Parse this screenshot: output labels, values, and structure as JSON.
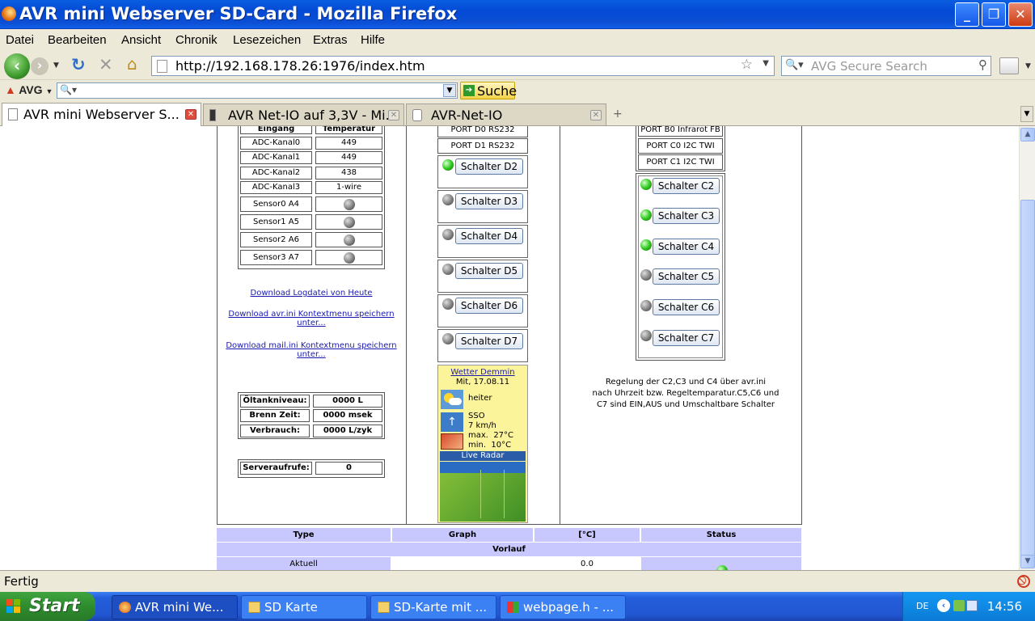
{
  "window": {
    "title": "AVR mini Webserver SD-Card - Mozilla Firefox",
    "min": "_",
    "max": "❐",
    "close": "✕"
  },
  "menu": [
    "Datei",
    "Bearbeiten",
    "Ansicht",
    "Chronik",
    "Lesezeichen",
    "Extras",
    "Hilfe"
  ],
  "nav": {
    "url": "http://192.168.178.26:1976/index.htm",
    "search_placeholder": "AVG Secure Search"
  },
  "avg": {
    "logo": "AVG",
    "search_button": "Suche"
  },
  "tabs": [
    {
      "label": "AVR mini Webserver S..."
    },
    {
      "label": "AVR Net-IO auf 3,3V - Mi..."
    },
    {
      "label": "AVR-Net-IO"
    }
  ],
  "page": {
    "left": {
      "head": [
        "Eingang",
        "Temperatur"
      ],
      "rows": [
        {
          "name": "ADC-Kanal0",
          "val": "449"
        },
        {
          "name": "ADC-Kanal1",
          "val": "449"
        },
        {
          "name": "ADC-Kanal2",
          "val": "438"
        },
        {
          "name": "ADC-Kanal3",
          "val": "1-wire"
        }
      ],
      "sensors": [
        "Sensor0 A4",
        "Sensor1 A5",
        "Sensor2 A6",
        "Sensor3 A7"
      ],
      "links": [
        "Download Logdatei von Heute",
        "Download avr.ini Kontextmenu speichern unter...",
        "Download mail.ini Kontextmenu speichern unter..."
      ],
      "stats": [
        {
          "label": "Öltankniveau:",
          "val": "0000 L"
        },
        {
          "label": "Brenn Zeit:",
          "val": "0000 msek"
        },
        {
          "label": "Verbrauch:",
          "val": "0000 L/zyk"
        }
      ],
      "server": {
        "label": "Serveraufrufe:",
        "val": "0"
      }
    },
    "middle": {
      "ports": [
        "PORT D0 RS232",
        "PORT D1 RS232"
      ],
      "switches": [
        {
          "label": "Schalter D2",
          "state": "green"
        },
        {
          "label": "Schalter D3",
          "state": "gray"
        },
        {
          "label": "Schalter D4",
          "state": "gray"
        },
        {
          "label": "Schalter D5",
          "state": "gray"
        },
        {
          "label": "Schalter D6",
          "state": "gray"
        },
        {
          "label": "Schalter D7",
          "state": "gray"
        }
      ],
      "weather": {
        "title": "Wetter Demmin",
        "date": "Mit, 17.08.11",
        "condition": "heiter",
        "wind_dir": "SSO",
        "wind_speed": "7 km/h",
        "max": "max.  27°C",
        "min": "min.  10°C",
        "radar": "Live Radar"
      }
    },
    "right": {
      "ports": [
        "PORT B0 Infrarot FB",
        "PORT C0 I2C TWI",
        "PORT C1 I2C TWI"
      ],
      "switches": [
        {
          "label": "Schalter C2",
          "state": "green"
        },
        {
          "label": "Schalter C3",
          "state": "green"
        },
        {
          "label": "Schalter C4",
          "state": "green"
        },
        {
          "label": "Schalter C5",
          "state": "gray"
        },
        {
          "label": "Schalter C6",
          "state": "gray"
        },
        {
          "label": "Schalter C7",
          "state": "gray"
        }
      ],
      "note": [
        "Regelung der C2,C3 und C4 über avr.ini",
        "nach Uhrzeit bzw. Regeltemparatur.C5,C6 und",
        "C7 sind EIN,AUS und Umschaltbare Schalter"
      ]
    },
    "bottom": {
      "headers": [
        "Type",
        "Graph",
        "[°C]",
        "Status"
      ],
      "verlauf": "Vorlauf",
      "row": {
        "type": "Aktuell",
        "temp": "0.0"
      }
    }
  },
  "status": "Fertig",
  "taskbar": {
    "start": "Start",
    "tasks": [
      "AVR mini We...",
      "SD Karte",
      "SD-Karte mit ...",
      "webpage.h - ..."
    ],
    "lang": "DE",
    "clock": "14:56"
  }
}
